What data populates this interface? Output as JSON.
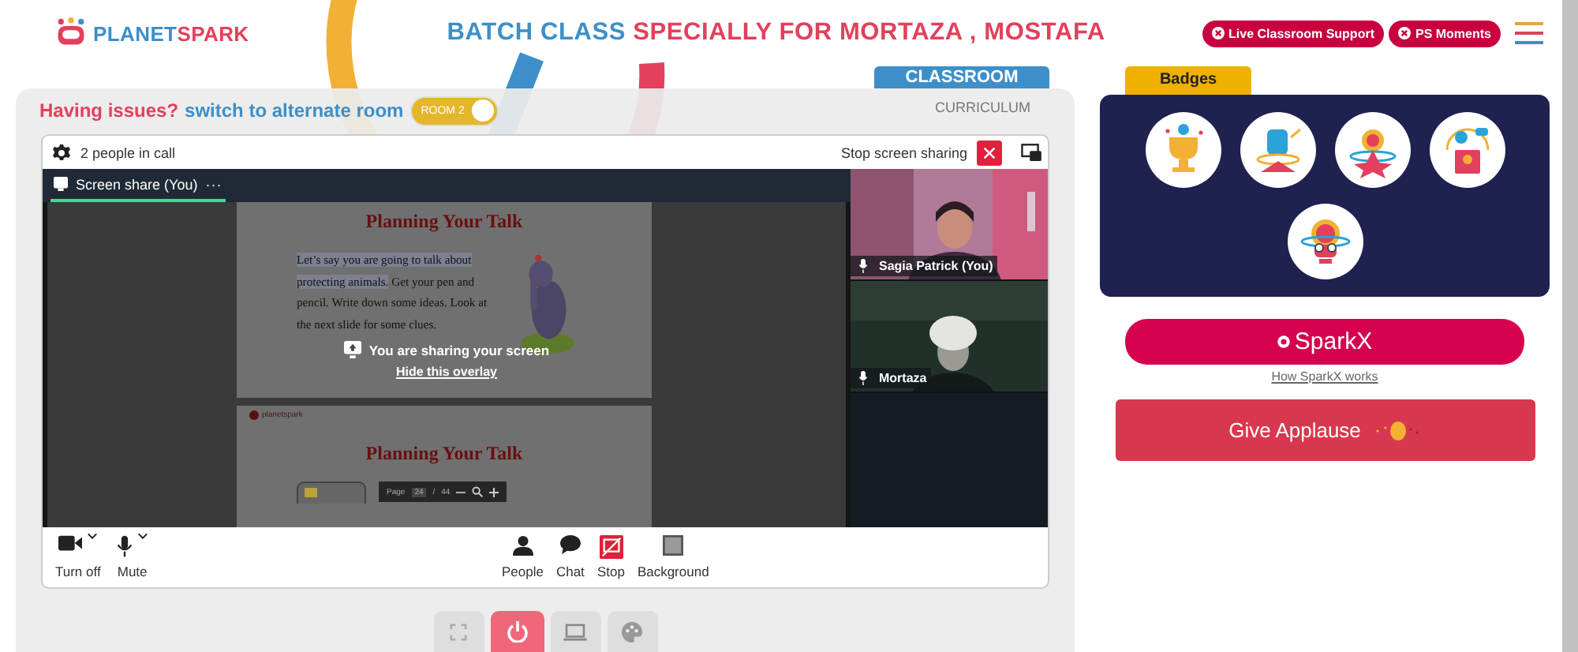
{
  "header": {
    "logo": {
      "part_1": "PLANET",
      "part_2": "SPARK"
    },
    "title": {
      "lead": "BATCH CLASS",
      "rest": "SPECIALLY FOR MORTAZA , MOSTAFA"
    },
    "buttons": [
      {
        "label": "Live Classroom Support"
      },
      {
        "label": "PS Moments"
      }
    ]
  },
  "tabs": [
    {
      "label": "CLASSROOM",
      "selected": true
    },
    {
      "label": "CURRICULUM",
      "selected": false
    }
  ],
  "issue_bar": {
    "question": "Having issues?",
    "link": "switch to alternate room",
    "toggle": {
      "label": "ROOM 2",
      "on": true
    }
  },
  "call": {
    "people": "2 people in call",
    "stop_sharing": "Stop screen sharing",
    "stage_tab": {
      "label": "Screen share (You)",
      "more": "···"
    },
    "slides": [
      {
        "title": "Planning Your Talk",
        "highlighted": "Let’s say you are going to talk about protecting animals.",
        "text": " Get your pen and pencil. Write down some ideas. Look at the next slide for some clues."
      },
      {
        "logo": "planetspark",
        "title": "Planning Your Talk"
      }
    ],
    "pdf_toolbar": {
      "page_label": "Page",
      "page": "24",
      "separator": "/",
      "total": "44"
    },
    "overlay": {
      "message": "You are sharing your screen",
      "link": "Hide this overlay"
    },
    "participants": [
      {
        "name": "Sagia Patrick (You)"
      },
      {
        "name": "Mortaza"
      }
    ],
    "controls": [
      {
        "kind": "camera",
        "label": "Turn off",
        "dropdown": true
      },
      {
        "kind": "mic",
        "label": "Mute",
        "dropdown": true
      },
      {
        "kind": "people",
        "label": "People",
        "dropdown": false
      },
      {
        "kind": "chat",
        "label": "Chat",
        "dropdown": false
      },
      {
        "kind": "stop",
        "label": "Stop",
        "dropdown": false
      },
      {
        "kind": "background",
        "label": "Background",
        "dropdown": false
      }
    ]
  },
  "bottom_buttons": [
    {
      "kind": "fullscreen"
    },
    {
      "kind": "power"
    },
    {
      "kind": "screen"
    },
    {
      "kind": "palette"
    }
  ],
  "badges": {
    "title": "Badges",
    "items": [
      {
        "kind": "trophy"
      },
      {
        "kind": "fist"
      },
      {
        "kind": "star"
      },
      {
        "kind": "podium"
      },
      {
        "kind": "brain"
      }
    ]
  },
  "sparkx": {
    "label": "SparkX",
    "link": "How SparkX works"
  },
  "applause": {
    "label": "Give Applause"
  }
}
